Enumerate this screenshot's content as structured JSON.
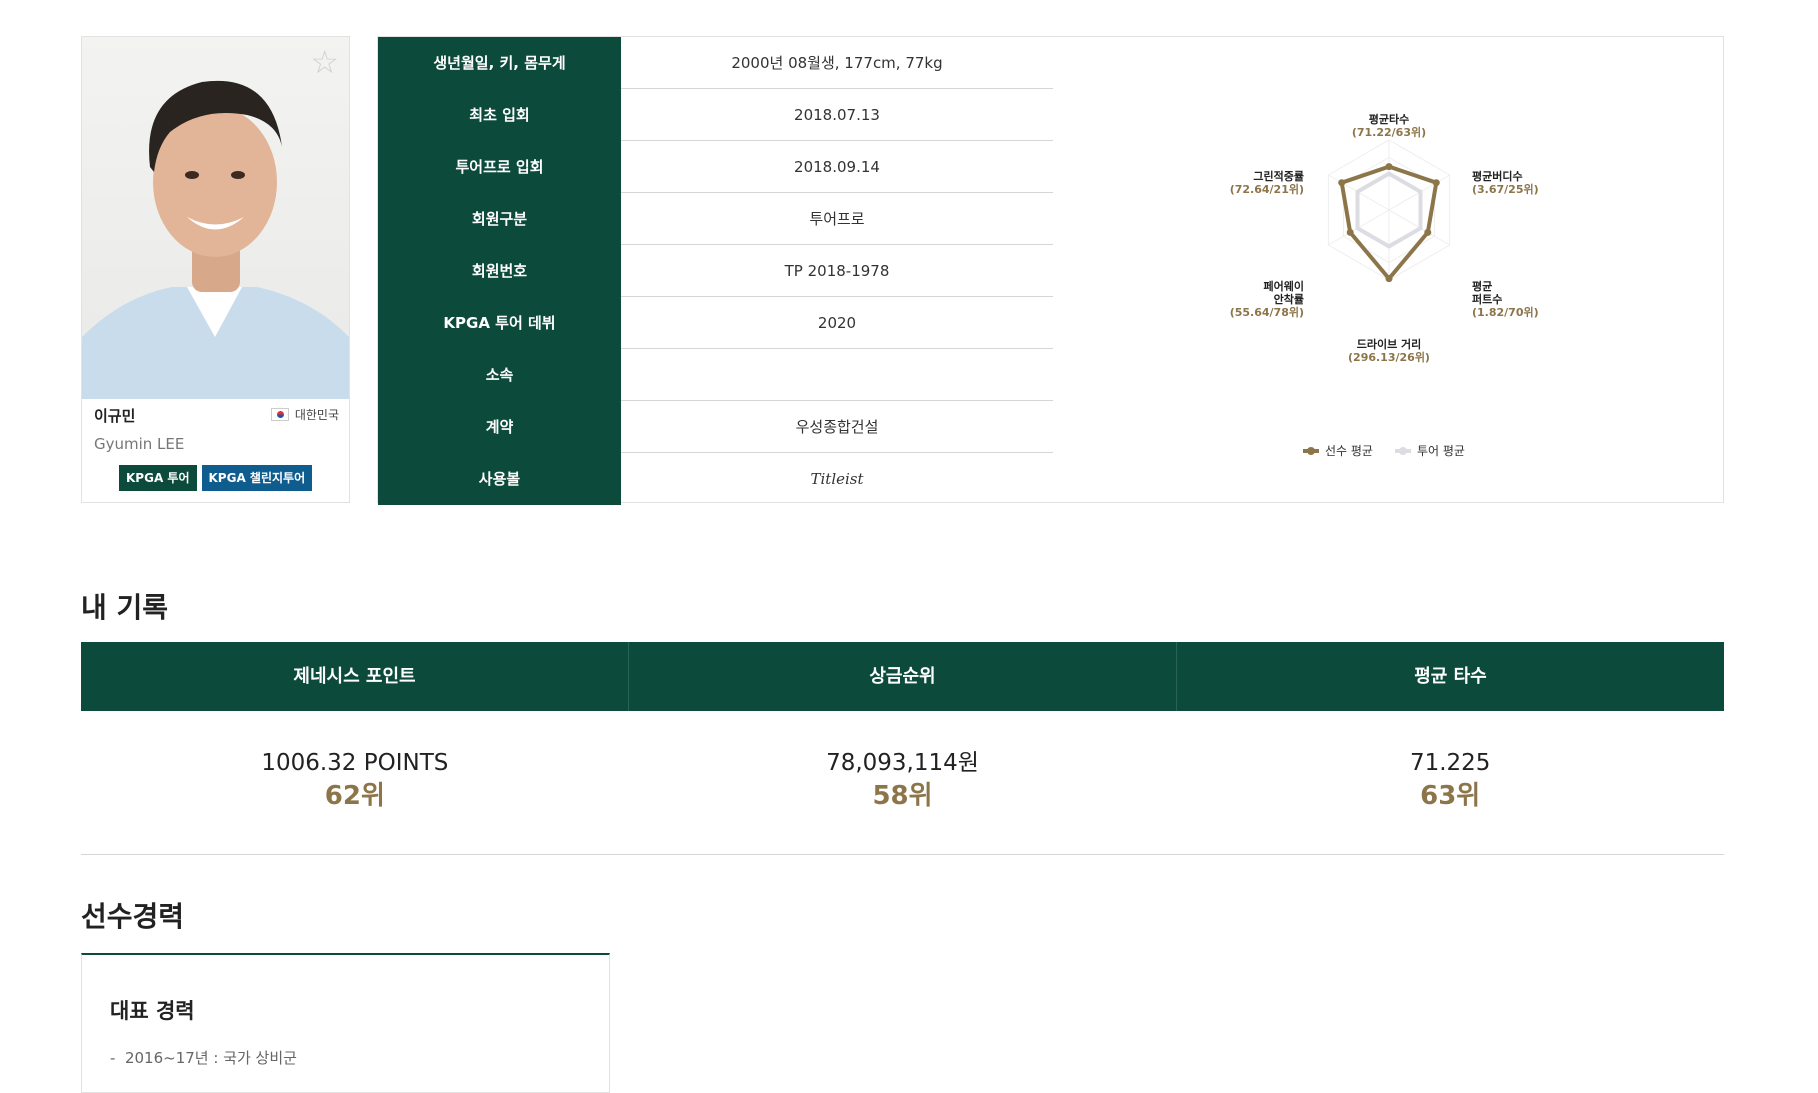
{
  "top_text": "...",
  "profile": {
    "name": "이규민",
    "english_name": "Gyumin LEE",
    "nationality": "대한민국",
    "tags": [
      "KPGA 투어",
      "KPGA 챌린지투어"
    ]
  },
  "info": {
    "rows": [
      {
        "label": "생년월일, 키, 몸무게",
        "value": "2000년 08월생, 177cm, 77kg"
      },
      {
        "label": "최초 입회",
        "value": "2018.07.13"
      },
      {
        "label": "투어프로 입회",
        "value": "2018.09.14"
      },
      {
        "label": "회원구분",
        "value": "투어프로"
      },
      {
        "label": "회원번호",
        "value": "TP 2018-1978"
      },
      {
        "label": "KPGA 투어 데뷔",
        "value": "2020"
      },
      {
        "label": "소속",
        "value": ""
      },
      {
        "label": "계약",
        "value": "우성종합건설"
      },
      {
        "label": "사용볼",
        "value": "Titleist"
      }
    ]
  },
  "radar": {
    "axes": [
      {
        "name": "평균타수",
        "value": "(71.22/63위)"
      },
      {
        "name": "평균버디수",
        "value": "(3.67/25위)"
      },
      {
        "name": "평균 퍼트수",
        "name_line1": "평균",
        "name_line2": "퍼트수",
        "value": "(1.82/70위)"
      },
      {
        "name": "드라이브 거리",
        "value": "(296.13/26위)"
      },
      {
        "name": "페어웨이 안착률",
        "name_line1": "페어웨이",
        "name_line2": "안착률",
        "value": "(55.64/78위)"
      },
      {
        "name": "그린적중률",
        "value": "(72.64/21위)"
      }
    ],
    "player_levels": [
      0.62,
      0.78,
      0.64,
      0.98,
      0.64,
      0.78
    ],
    "tour_levels": [
      0.52,
      0.52,
      0.52,
      0.52,
      0.52,
      0.52
    ],
    "legend": [
      "선수 평균",
      "투어 평균"
    ],
    "colors": {
      "player": "#8c7549",
      "tour": "#dcdde3"
    }
  },
  "records": {
    "title": "내 기록",
    "columns": [
      {
        "header": "제네시스 포인트",
        "value": "1006.32 POINTS",
        "rank": "62위"
      },
      {
        "header": "상금순위",
        "value": "78,093,114원",
        "rank": "58위"
      },
      {
        "header": "평균 타수",
        "value": "71.225",
        "rank": "63위"
      }
    ]
  },
  "career": {
    "title": "선수경력",
    "box_title": "대표 경력",
    "items": [
      "2016~17년 : 국가 상비군"
    ]
  },
  "colors": {
    "primary": "#0c4a3b",
    "gold": "#8c7549",
    "blue": "#0e5d8e"
  }
}
